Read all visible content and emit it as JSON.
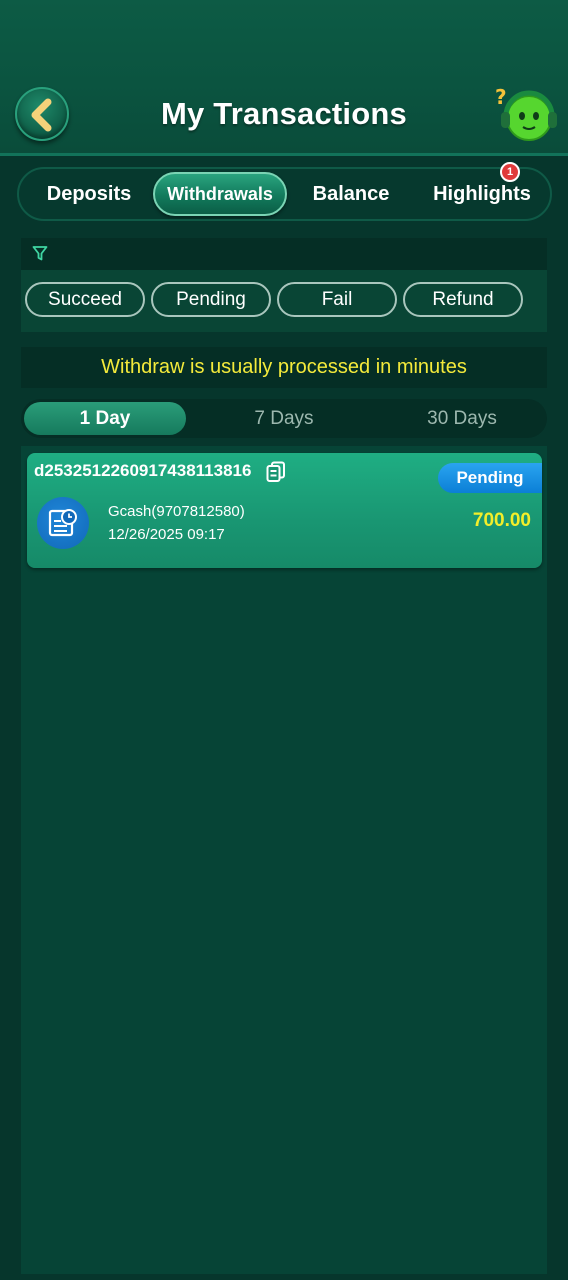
{
  "header": {
    "title": "My Transactions",
    "back_icon": "chevron-left-icon",
    "support_icon": "support-agent-icon"
  },
  "tabs": [
    {
      "label": "Deposits",
      "active": false
    },
    {
      "label": "Withdrawals",
      "active": true
    },
    {
      "label": "Balance",
      "active": false
    },
    {
      "label": "Highlights",
      "active": false,
      "badge": "1"
    }
  ],
  "filters": {
    "icon": "filter-icon",
    "chips": [
      "Succeed",
      "Pending",
      "Fail",
      "Refund"
    ]
  },
  "notice": "Withdraw is usually processed in minutes",
  "ranges": [
    {
      "label": "1 Day",
      "active": true
    },
    {
      "label": "7 Days",
      "active": false
    },
    {
      "label": "30 Days",
      "active": false
    }
  ],
  "transactions": [
    {
      "order_id": "d2532512260917438113816",
      "status": "Pending",
      "method": "Gcash(9707812580)",
      "time": "12/26/2025 09:17",
      "amount": "700.00"
    }
  ],
  "colors": {
    "background": "#06362c",
    "accent_green": "#1fae83",
    "notice_yellow": "#f4ea3b",
    "pending_blue": "#0b7fd6",
    "amount_yellow": "#f2ee2a"
  }
}
